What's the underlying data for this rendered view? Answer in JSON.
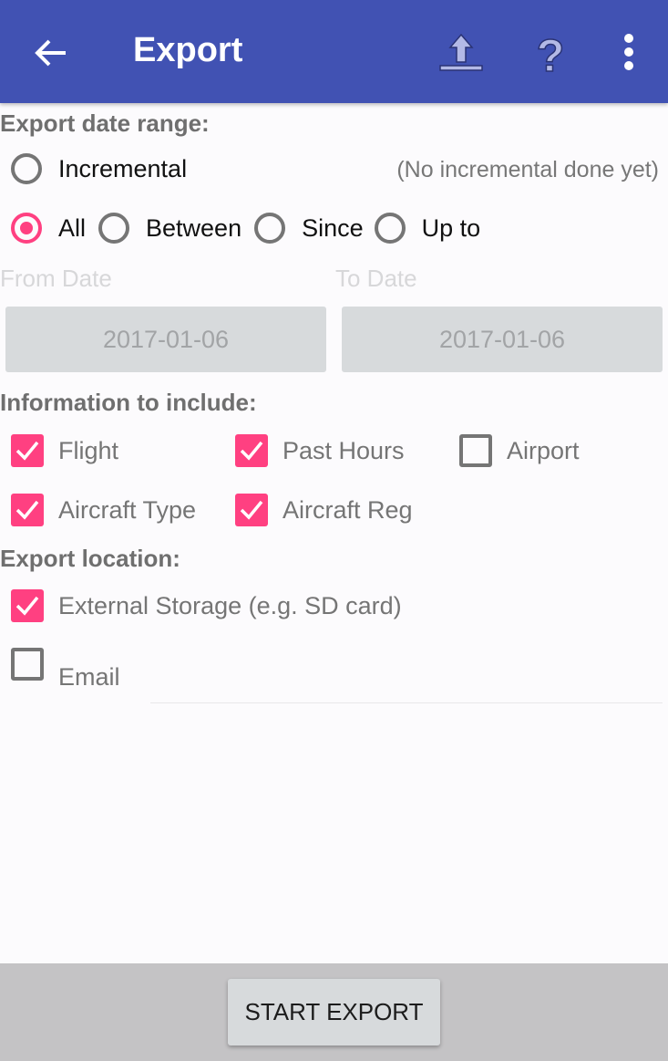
{
  "appbar": {
    "title": "Export",
    "back_icon": "arrow-left",
    "actions": [
      "upload-icon",
      "help-icon",
      "overflow-menu-icon"
    ],
    "color": "#4152b3"
  },
  "date_range": {
    "heading": "Export date range:",
    "incremental": {
      "label": "Incremental",
      "selected": false,
      "note": "(No incremental done yet)"
    },
    "options": [
      {
        "label": "All",
        "selected": true
      },
      {
        "label": "Between",
        "selected": false
      },
      {
        "label": "Since",
        "selected": false
      },
      {
        "label": "Up to",
        "selected": false
      }
    ],
    "from_label": "From Date",
    "to_label": "To Date",
    "from_value": "2017-01-06",
    "to_value": "2017-01-06"
  },
  "info": {
    "heading": "Information to include:",
    "items": [
      {
        "label": "Flight",
        "checked": true
      },
      {
        "label": "Past Hours",
        "checked": true
      },
      {
        "label": "Airport",
        "checked": false
      },
      {
        "label": "Aircraft Type",
        "checked": true
      },
      {
        "label": "Aircraft Reg",
        "checked": true
      }
    ]
  },
  "location": {
    "heading": "Export location:",
    "items": [
      {
        "label": "External Storage (e.g. SD card)",
        "checked": true
      },
      {
        "label": "Email",
        "checked": false
      }
    ],
    "email_value": ""
  },
  "start_button": "START EXPORT",
  "accent": "#ff4081"
}
